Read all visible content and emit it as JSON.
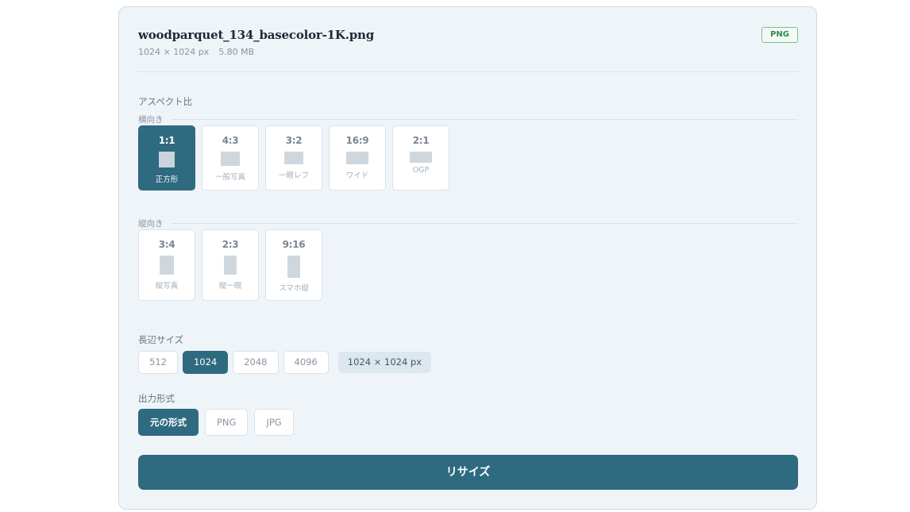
{
  "file": {
    "name": "woodparquet_134_basecolor-1K.png",
    "dimensions": "1024 × 1024 px",
    "size": "5.80 MB",
    "format_badge": "PNG"
  },
  "aspect": {
    "title": "アスペクト比",
    "landscape_heading": "横向き",
    "portrait_heading": "縦向き",
    "landscape": [
      {
        "ratio": "1:1",
        "label": "正方形",
        "selected": true
      },
      {
        "ratio": "4:3",
        "label": "一般写真",
        "selected": false
      },
      {
        "ratio": "3:2",
        "label": "一眼レフ",
        "selected": false
      },
      {
        "ratio": "16:9",
        "label": "ワイド",
        "selected": false
      },
      {
        "ratio": "2:1",
        "label": "OGP",
        "selected": false
      }
    ],
    "portrait": [
      {
        "ratio": "3:4",
        "label": "縦写真",
        "selected": false
      },
      {
        "ratio": "2:3",
        "label": "縦一眼",
        "selected": false
      },
      {
        "ratio": "9:16",
        "label": "スマホ縦",
        "selected": false
      }
    ]
  },
  "long_side": {
    "title": "長辺サイズ",
    "options": [
      "512",
      "1024",
      "2048",
      "4096"
    ],
    "selected": "1024",
    "result": "1024 × 1024 px"
  },
  "output_format": {
    "title": "出力形式",
    "options": [
      "元の形式",
      "PNG",
      "JPG"
    ],
    "selected": "元の形式"
  },
  "resize_button": "リサイズ"
}
